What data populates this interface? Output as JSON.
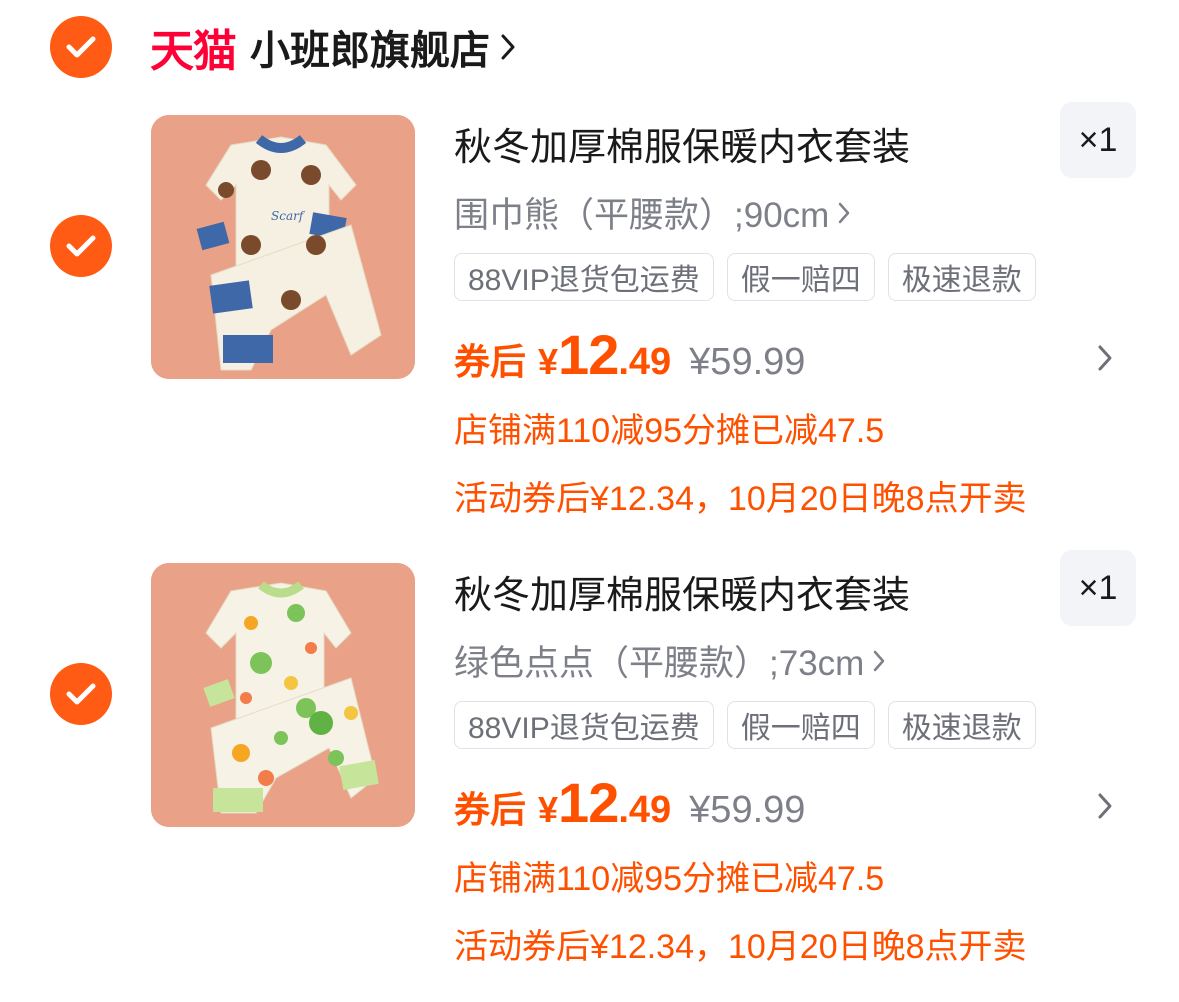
{
  "shop": {
    "platform": "天猫",
    "name": "小班郎旗舰店",
    "platform_color": "#ff0036"
  },
  "accent_color": "#ff5000",
  "items": [
    {
      "title": "秋冬加厚棉服保暖内衣套装",
      "spec": "围巾熊（平腰款）;90cm",
      "quantity": "×1",
      "tags": [
        "88VIP退货包运费",
        "假一赔四",
        "极速退款"
      ],
      "coupon_label": "券后",
      "currency": "¥",
      "price_int": "12",
      "price_dec": ".49",
      "original_price": "¥59.99",
      "promo_line1": "店铺满110减95分摊已减47.5",
      "promo_line2": "活动券后¥12.34，10月20日晚8点开卖",
      "image_desc_icon": "bear-pajama-image"
    },
    {
      "title": "秋冬加厚棉服保暖内衣套装",
      "spec": "绿色点点（平腰款）;73cm",
      "quantity": "×1",
      "tags": [
        "88VIP退货包运费",
        "假一赔四",
        "极速退款"
      ],
      "coupon_label": "券后",
      "currency": "¥",
      "price_int": "12",
      "price_dec": ".49",
      "original_price": "¥59.99",
      "promo_line1": "店铺满110减95分摊已减47.5",
      "promo_line2": "活动券后¥12.34，10月20日晚8点开卖",
      "image_desc_icon": "dots-pajama-image"
    }
  ]
}
